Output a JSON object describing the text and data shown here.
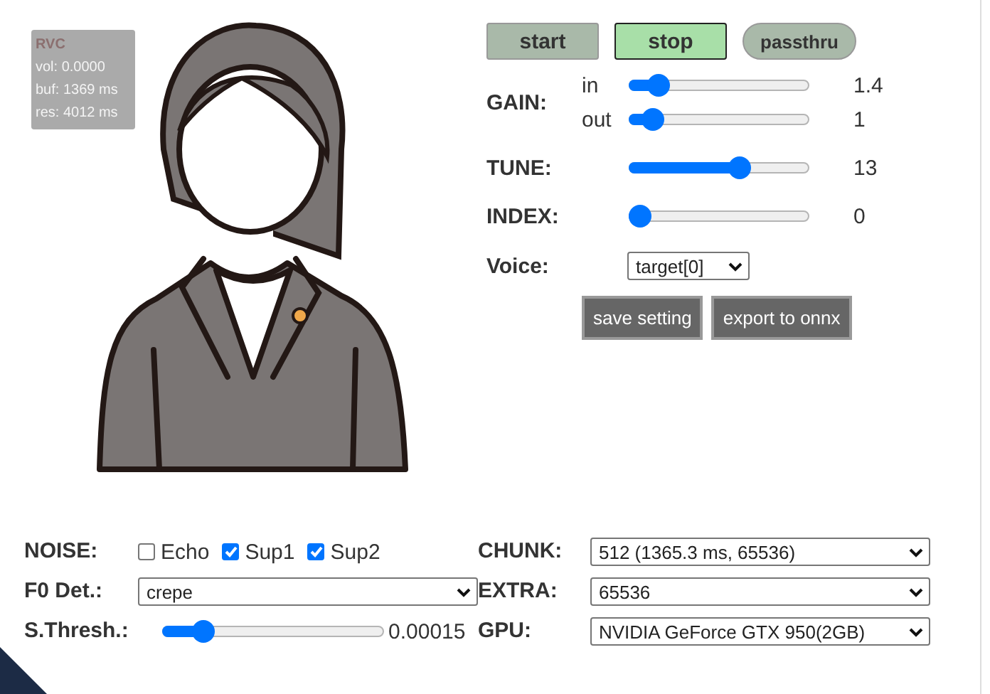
{
  "stats": {
    "title": "RVC",
    "lines": [
      "vol: 0.0000",
      "buf: 1369 ms",
      "res: 4012 ms"
    ]
  },
  "buttons": [
    {
      "label": "start",
      "kind": "button",
      "active": false
    },
    {
      "label": "stop",
      "kind": "button",
      "active": true
    },
    {
      "label": "passthru",
      "kind": "toggle",
      "on": false
    }
  ],
  "gain": {
    "label": "GAIN:",
    "channels": [
      {
        "label": "in",
        "level": 0.12,
        "reading": "1.4"
      },
      {
        "label": "out",
        "level": 0.08,
        "reading": "1"
      }
    ]
  },
  "sliders": [
    {
      "label": "TUNE:",
      "level": 0.63,
      "reading": "13"
    },
    {
      "label": "INDEX:",
      "level": 0,
      "reading": "0"
    }
  ],
  "voice": {
    "label": "Voice:",
    "value": "target[0]"
  },
  "actions": [
    "save setting",
    "export to onnx"
  ],
  "noise": {
    "label": "NOISE:",
    "options": [
      {
        "label": "Echo",
        "checked": false
      },
      {
        "label": "Sup1",
        "checked": true
      },
      {
        "label": "Sup2",
        "checked": true
      }
    ]
  },
  "f0": {
    "label": "F0 Det.:",
    "value": "crepe"
  },
  "threshold": {
    "label": "S.Thresh.:",
    "level": 0.15,
    "reading": "0.00015"
  },
  "chunk": {
    "label": "CHUNK:",
    "value": "512 (1365.3 ms, 65536)"
  },
  "extra": {
    "label": "EXTRA:",
    "value": "65536"
  },
  "gpu": {
    "label": "GPU:",
    "value": "NVIDIA GeForce GTX 950(2GB)"
  }
}
